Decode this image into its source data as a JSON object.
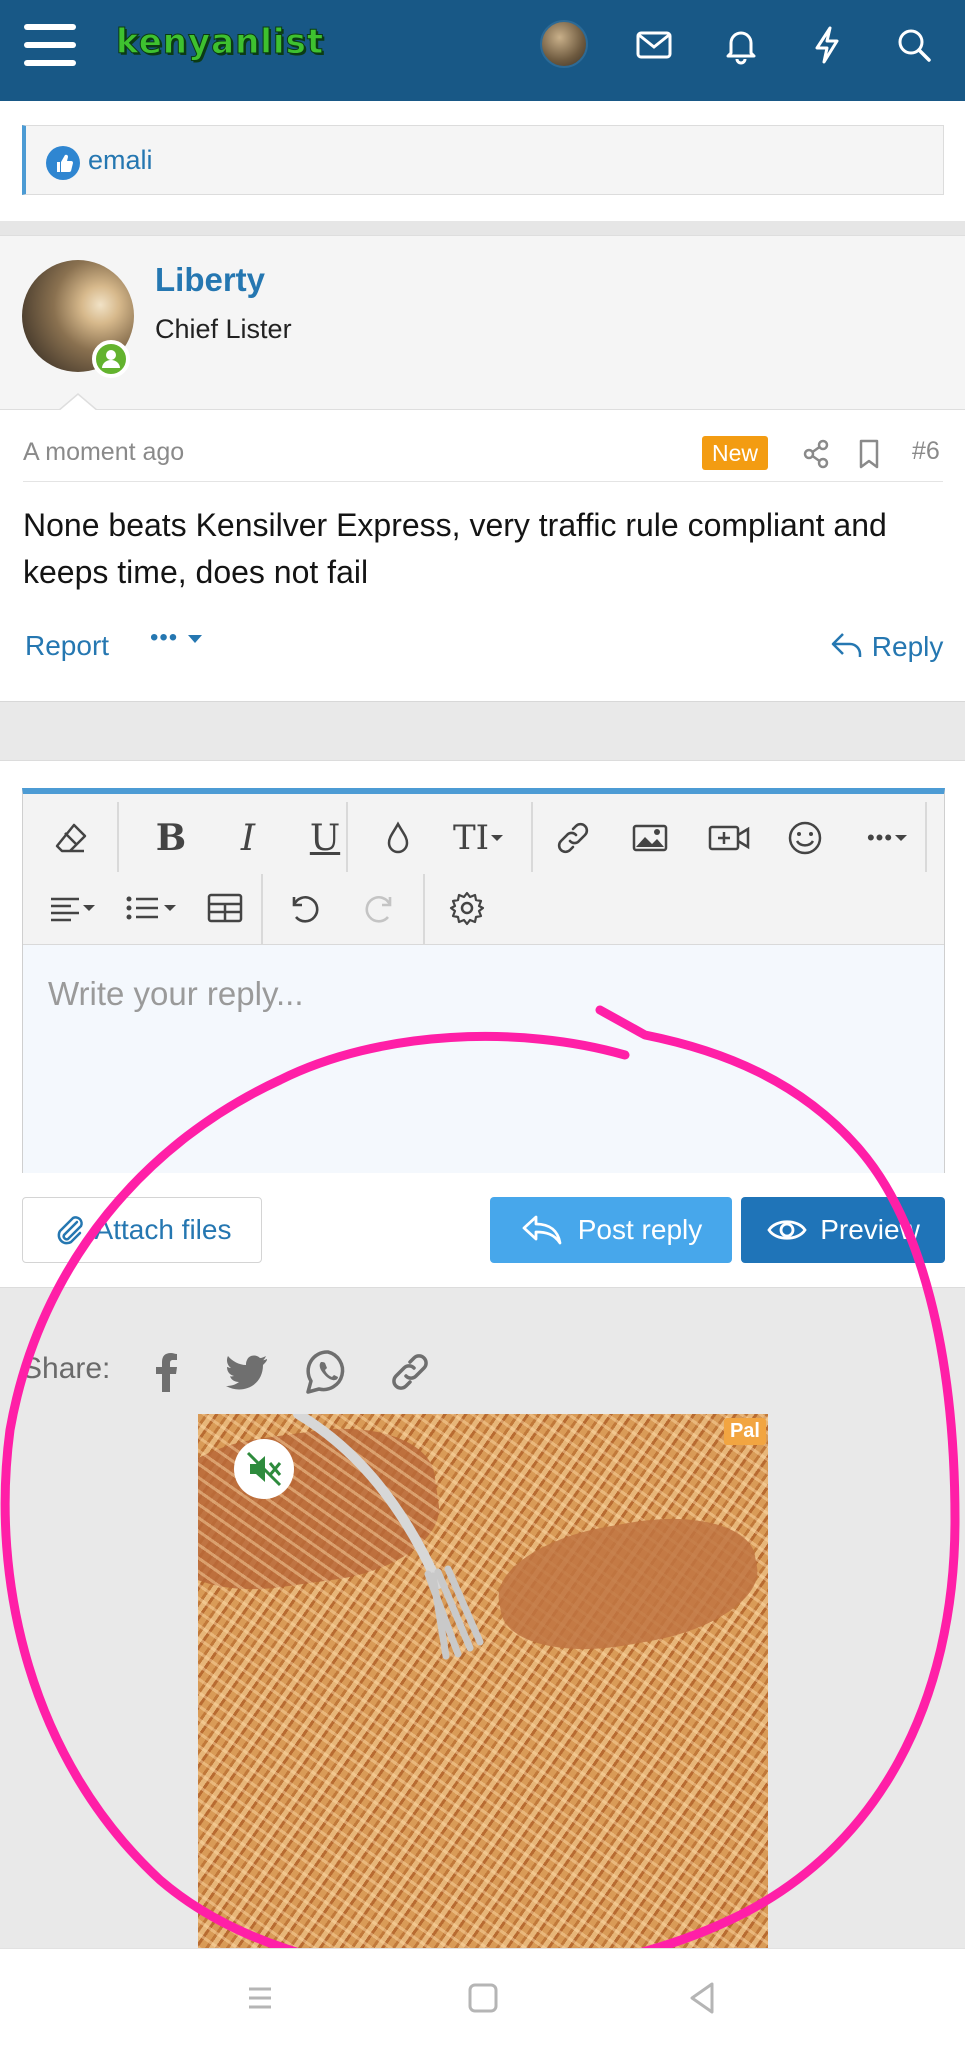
{
  "header": {
    "logo_text": "kenyanlist",
    "icons": [
      "menu-icon",
      "avatar",
      "mail-icon",
      "bell-icon",
      "lightning-icon",
      "search-icon"
    ]
  },
  "reactions": {
    "icon": "thumbs-up-icon",
    "names": "emali"
  },
  "post": {
    "username": "Liberty",
    "user_title": "Chief Lister",
    "time": "A moment ago",
    "badge": "New",
    "number": "#6",
    "body": "None beats Kensilver Express, very traffic rule compliant and keeps time, does not fail",
    "report_label": "Report",
    "more_label": "•••",
    "reply_label": "Reply"
  },
  "editor": {
    "placeholder": "Write your reply...",
    "toolbar_row1": [
      "eraser",
      "B",
      "I",
      "U",
      "color",
      "text-size",
      "link",
      "image",
      "video",
      "emoji",
      "more"
    ],
    "toolbar_row2": [
      "align",
      "list",
      "table",
      "undo",
      "redo",
      "settings"
    ]
  },
  "actions": {
    "attach_label": "Attach files",
    "post_reply_label": "Post reply",
    "preview_label": "Preview"
  },
  "share": {
    "label": "Share:",
    "icons": [
      "facebook-icon",
      "twitter-icon",
      "whatsapp-icon",
      "link-icon"
    ]
  },
  "ad": {
    "badge": "Pal",
    "mute_icon": "speaker-muted-icon"
  },
  "colors": {
    "header_bg": "#185886",
    "link_blue": "#2577b1",
    "accent_blue": "#4c9bd4",
    "new_badge": "#f39c12",
    "annotation_pink": "#ff1fa7"
  }
}
